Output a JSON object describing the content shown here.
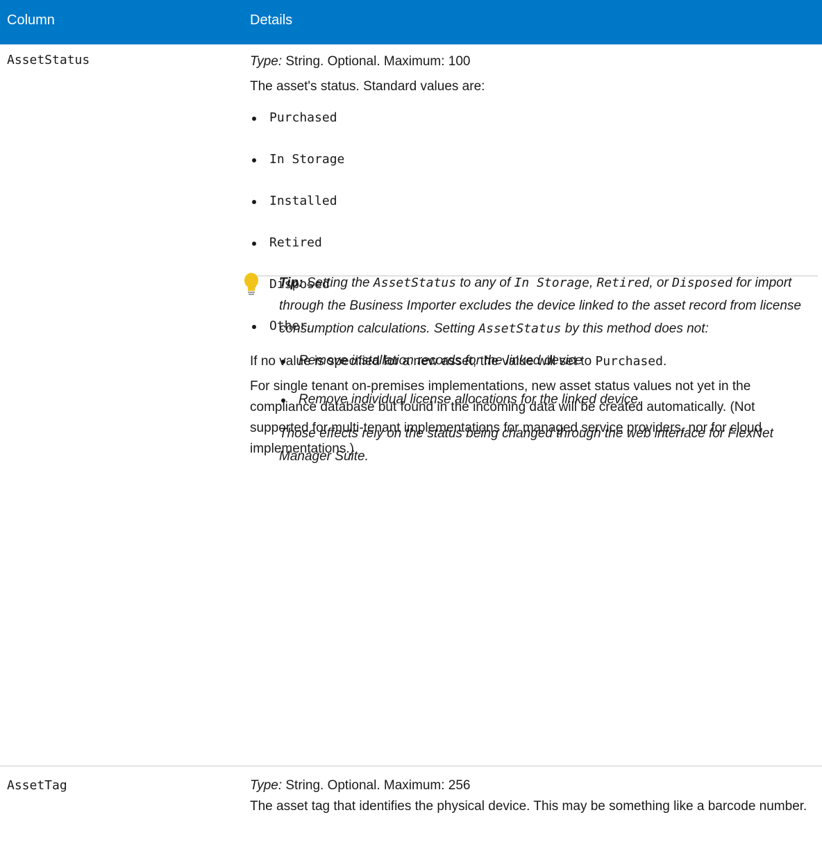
{
  "header": {
    "column_label": "Column",
    "details_label": "Details"
  },
  "rows": [
    {
      "column": "AssetStatus",
      "type_label": "Type:",
      "type_text": " String. Optional. Maximum: 100",
      "intro": "The asset's status. Standard values are:",
      "values": [
        "Purchased",
        "In Storage",
        "Installed",
        "Retired",
        "Disposed",
        "Other"
      ],
      "values_last_suffix": ".",
      "default_text_prefix": "If no value is specified for a new asset, the value will set to ",
      "default_value": "Purchased",
      "default_text_suffix": ".",
      "onprem_note": "For single tenant on-premises implementations, new asset status values not yet in the compliance database but found in the incoming data will be created automatically. (Not supported for multi-tenant implementations for managed service providers, nor for cloud implementations.)",
      "tip": {
        "label": "Tip:",
        "part1": " Setting the ",
        "code1": "AssetStatus",
        "part2": " to any of ",
        "code2": "In Storage",
        "part3": ", ",
        "code3": "Retired",
        "part4": ", or ",
        "code4": "Disposed",
        "part5": " for import through the Business Importer excludes the device linked to the asset record from license consumption calculations. Setting ",
        "code5": "AssetStatus",
        "part6": " by this method does not:",
        "bullets": [
          "Remove installation records for the linked device",
          "Remove individual license allocations for the linked device."
        ],
        "closing": "Those effects rely on the status being changed through the web interface for FlexNet Manager Suite."
      }
    },
    {
      "column": "AssetTag",
      "type_label": "Type:",
      "type_text": " String. Optional. Maximum: 256",
      "description": "The asset tag that identifies the physical device. This may be something like a barcode number."
    }
  ],
  "colors": {
    "header_bg": "#0078c8",
    "header_text": "#ffffff",
    "rule": "#c8c8c8",
    "bulb": "#f2c41b"
  },
  "icons": {
    "tip": "lightbulb-icon"
  }
}
